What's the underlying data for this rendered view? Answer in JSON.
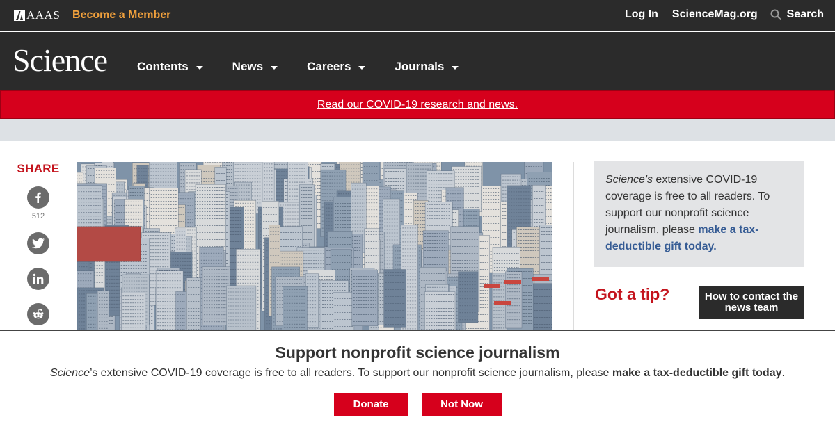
{
  "topbar": {
    "org_logo_text": "AAAS",
    "become_member": "Become a Member",
    "login": "Log In",
    "sciencemag": "ScienceMag.org",
    "search": "Search",
    "accent_color": "#f0a03c"
  },
  "masthead": {
    "logo": "Science",
    "nav": [
      {
        "label": "Contents",
        "icon": "caret-down"
      },
      {
        "label": "News",
        "icon": "caret-down"
      },
      {
        "label": "Careers",
        "icon": "caret-down"
      },
      {
        "label": "Journals",
        "icon": "caret-down"
      }
    ]
  },
  "covid_banner": {
    "link_text": "Read our COVID-19 research and news.",
    "color": "#d6001c"
  },
  "share": {
    "title": "SHARE",
    "buttons": [
      {
        "icon": "facebook-icon",
        "count": "512"
      },
      {
        "icon": "twitter-icon"
      },
      {
        "icon": "linkedin-icon"
      },
      {
        "icon": "reddit-icon"
      }
    ]
  },
  "hero": {
    "subject": "dense city skyline of high-rise apartment towers"
  },
  "sidebar": {
    "promo_em": "Science's",
    "promo_text": " extensive COVID-19 coverage is free to all readers. To support our nonprofit science journalism, please ",
    "promo_link": "make a tax-deductible gift today.",
    "tip_title": "Got a tip?",
    "contact_button": "How to contact the news team"
  },
  "donate_overlay": {
    "title": "Support nonprofit science journalism",
    "text_em": "Science",
    "text_body": "’s extensive COVID-19 coverage is free to all readers. To support our nonprofit science journalism, please ",
    "text_strong": "make a tax-deductible gift today",
    "text_end": ".",
    "donate_button": "Donate",
    "not_now_button": "Not Now"
  }
}
